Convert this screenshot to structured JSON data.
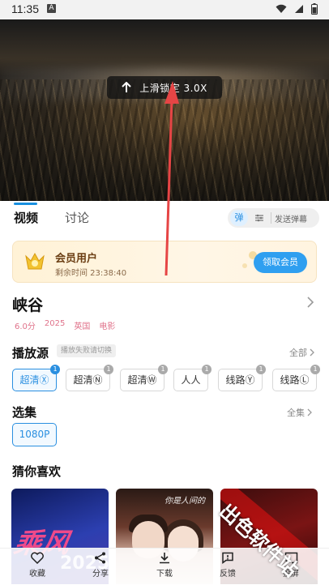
{
  "status_bar": {
    "time": "11:35",
    "notification_letter": "A"
  },
  "player": {
    "speed_toast": "上滑锁定 3.0X"
  },
  "tabs": [
    {
      "label": "视频",
      "active": true
    },
    {
      "label": "讨论",
      "active": false
    }
  ],
  "danmaku": {
    "toggle_label": "弹",
    "send_label": "发送弹幕"
  },
  "member": {
    "title": "会员用户",
    "remaining": "剩余时间 23:38:40",
    "button": "领取会员"
  },
  "movie": {
    "title": "峡谷",
    "rating": "6.0分",
    "year": "2025",
    "region": "英国",
    "category": "电影"
  },
  "sources": {
    "heading": "播放源",
    "hint": "播放失败请切换",
    "more": "全部",
    "items": [
      {
        "label": "超清Ⓧ",
        "count": "1",
        "active": true
      },
      {
        "label": "超清Ⓝ",
        "count": "1",
        "active": false
      },
      {
        "label": "超清Ⓦ",
        "count": "1",
        "active": false
      },
      {
        "label": "人人",
        "count": "1",
        "active": false
      },
      {
        "label": "线路Ⓨ",
        "count": "1",
        "active": false
      },
      {
        "label": "线路Ⓛ",
        "count": "1",
        "active": false
      }
    ]
  },
  "episodes": {
    "heading": "选集",
    "more": "全集",
    "items": [
      "1080P"
    ]
  },
  "recommend": {
    "heading": "猜你喜欢",
    "poster1_text": "乘风",
    "poster1_year": "2025",
    "poster2_script": "你是人间的"
  },
  "watermark": "出色软件站",
  "bottom_bar": [
    "收藏",
    "分享",
    "下载",
    "反馈",
    "投屏"
  ],
  "colors": {
    "accent": "#2a8fe0",
    "meta_pink": "#e0738b",
    "arrow_red": "#e64545",
    "member_button": "#2f9ff0"
  }
}
